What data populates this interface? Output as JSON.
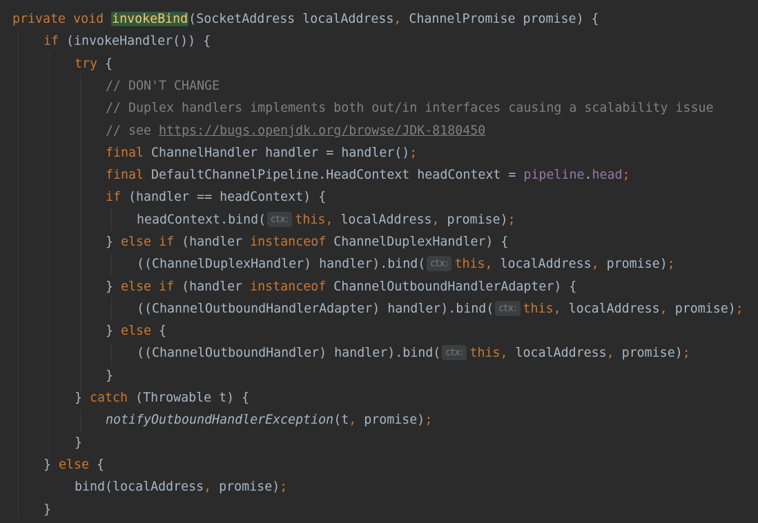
{
  "editor": {
    "language": "Java",
    "method_name": "invokeBind",
    "param_hint_label": "ctx:",
    "lines": [
      {
        "indent": 0,
        "text": "private void invokeBind(SocketAddress localAddress, ChannelPromise promise) {"
      },
      {
        "indent": 1,
        "text": "if (invokeHandler()) {"
      },
      {
        "indent": 2,
        "text": "try {"
      },
      {
        "indent": 3,
        "text": "// DON'T CHANGE"
      },
      {
        "indent": 3,
        "text": "// Duplex handlers implements both out/in interfaces causing a scalability issue"
      },
      {
        "indent": 3,
        "text": "// see https://bugs.openjdk.org/browse/JDK-8180450"
      },
      {
        "indent": 3,
        "text": "final ChannelHandler handler = handler();"
      },
      {
        "indent": 3,
        "text": "final DefaultChannelPipeline.HeadContext headContext = pipeline.head;"
      },
      {
        "indent": 3,
        "text": "if (handler == headContext) {"
      },
      {
        "indent": 4,
        "text": "headContext.bind(ctx: this, localAddress, promise);"
      },
      {
        "indent": 3,
        "text": "} else if (handler instanceof ChannelDuplexHandler) {"
      },
      {
        "indent": 4,
        "text": "((ChannelDuplexHandler) handler).bind(ctx: this, localAddress, promise);"
      },
      {
        "indent": 3,
        "text": "} else if (handler instanceof ChannelOutboundHandlerAdapter) {"
      },
      {
        "indent": 4,
        "text": "((ChannelOutboundHandlerAdapter) handler).bind(ctx: this, localAddress, promise);"
      },
      {
        "indent": 3,
        "text": "} else {"
      },
      {
        "indent": 4,
        "text": "((ChannelOutboundHandler) handler).bind(ctx: this, localAddress, promise);"
      },
      {
        "indent": 3,
        "text": "}"
      },
      {
        "indent": 2,
        "text": "} catch (Throwable t) {"
      },
      {
        "indent": 3,
        "text": "notifyOutboundHandlerException(t, promise);"
      },
      {
        "indent": 2,
        "text": "}"
      },
      {
        "indent": 1,
        "text": "} else {"
      },
      {
        "indent": 2,
        "text": "bind(localAddress, promise);"
      },
      {
        "indent": 1,
        "text": "}"
      }
    ]
  },
  "colors": {
    "background": "#2b2b2b",
    "keyword": "#cc7832",
    "identifier": "#a9b7c6",
    "comment": "#808080",
    "field": "#9876aa",
    "method_highlight_bg": "#32593d",
    "method_highlight_fg": "#ffc66d",
    "hint_bg": "#3b3f41",
    "indent_guide": "#3b3b3b"
  }
}
